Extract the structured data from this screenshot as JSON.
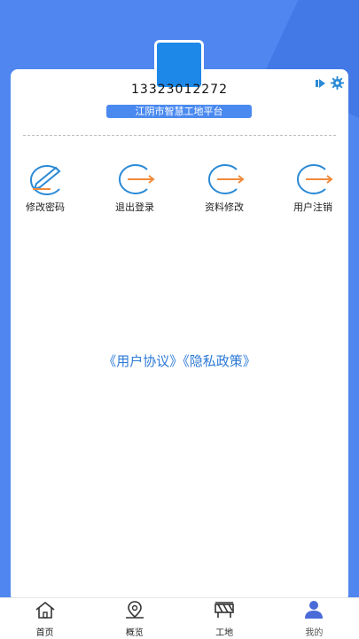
{
  "profile": {
    "phone": "13323012272",
    "platform": "江阴市智慧工地平台"
  },
  "header_icons": [
    "play-icon",
    "gear-icon"
  ],
  "actions": [
    {
      "label": "修改密码",
      "icon": "edit-pen-icon"
    },
    {
      "label": "退出登录",
      "icon": "logout-arrow-icon"
    },
    {
      "label": "资料修改",
      "icon": "profile-edit-icon"
    },
    {
      "label": "用户注销",
      "icon": "cancel-account-icon"
    }
  ],
  "agreement": {
    "user_agreement": "《用户协议》",
    "privacy_policy": "《隐私政策》"
  },
  "tabs": [
    {
      "label": "首页",
      "icon": "home-icon",
      "active": false
    },
    {
      "label": "概览",
      "icon": "location-pin-icon",
      "active": false
    },
    {
      "label": "工地",
      "icon": "construction-barrier-icon",
      "active": false
    },
    {
      "label": "我的",
      "icon": "user-icon",
      "active": true
    }
  ],
  "colors": {
    "background": "#4f86f0",
    "accent": "#1e88e8",
    "link": "#2d7ad6",
    "arrow": "#f08a3a"
  }
}
